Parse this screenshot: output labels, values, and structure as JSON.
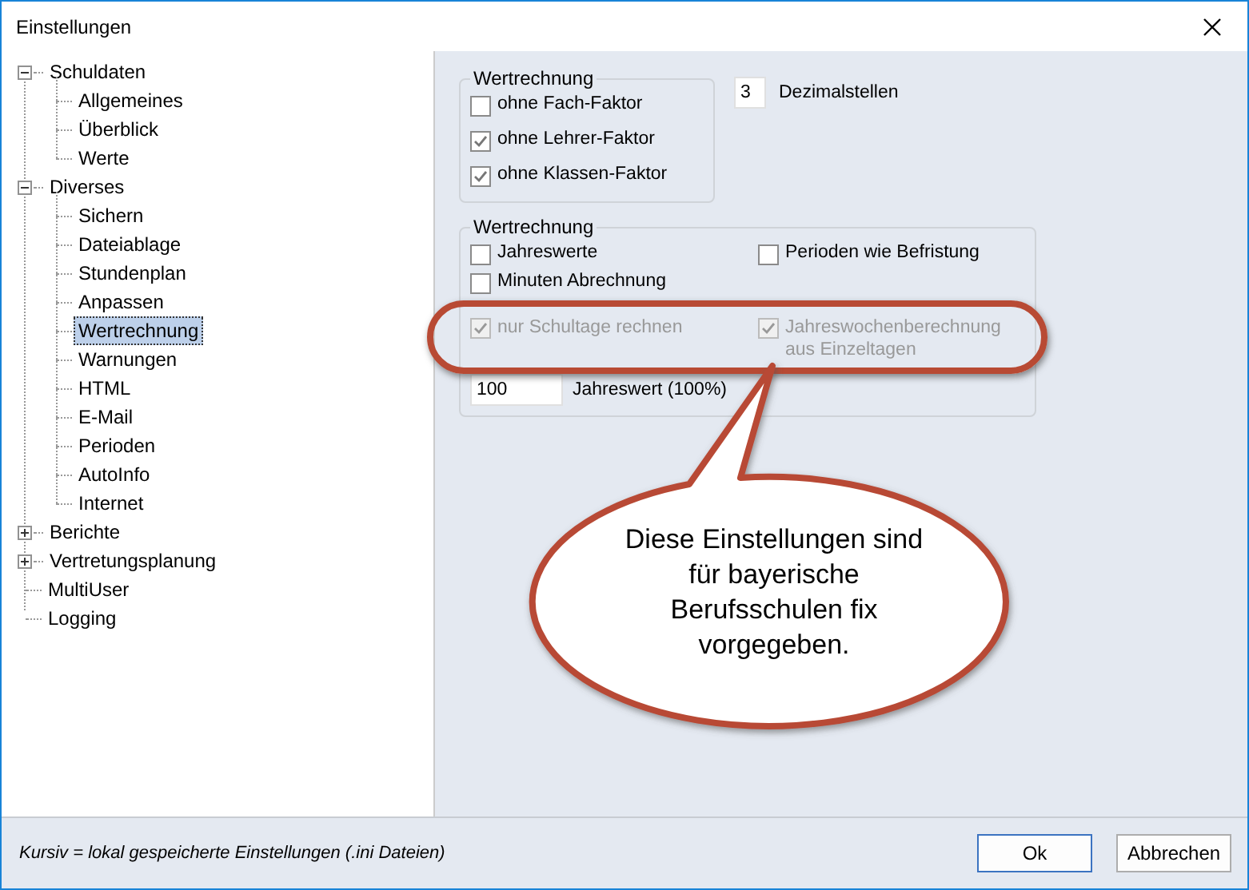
{
  "window": {
    "title": "Einstellungen"
  },
  "tree": [
    {
      "label": "Schuldaten",
      "expanded": true,
      "selected": false,
      "children": [
        {
          "label": "Allgemeines",
          "selected": false
        },
        {
          "label": "Überblick",
          "selected": false
        },
        {
          "label": "Werte",
          "selected": false
        }
      ]
    },
    {
      "label": "Diverses",
      "expanded": true,
      "selected": false,
      "children": [
        {
          "label": "Sichern",
          "selected": false
        },
        {
          "label": "Dateiablage",
          "selected": false
        },
        {
          "label": "Stundenplan",
          "selected": false
        },
        {
          "label": "Anpassen",
          "selected": false
        },
        {
          "label": "Wertrechnung",
          "selected": true
        },
        {
          "label": "Warnungen",
          "selected": false
        },
        {
          "label": "HTML",
          "selected": false
        },
        {
          "label": "E-Mail",
          "selected": false
        },
        {
          "label": "Perioden",
          "selected": false
        },
        {
          "label": "AutoInfo",
          "selected": false
        },
        {
          "label": "Internet",
          "selected": false
        }
      ]
    },
    {
      "label": "Berichte",
      "expanded": false,
      "selected": false
    },
    {
      "label": "Vertretungsplanung",
      "expanded": false,
      "selected": false
    },
    {
      "label": "MultiUser",
      "selected": false
    },
    {
      "label": "Logging",
      "selected": false
    }
  ],
  "group1": {
    "legend": "Wertrechnung",
    "checkboxes": [
      {
        "label": "ohne Fach-Faktor",
        "checked": false
      },
      {
        "label": "ohne Lehrer-Faktor",
        "checked": true
      },
      {
        "label": "ohne Klassen-Faktor",
        "checked": true
      }
    ]
  },
  "decimals": {
    "value": "3",
    "label": "Dezimalstellen"
  },
  "group2": {
    "legend": "Wertrechnung",
    "rows": [
      [
        {
          "label": "Jahreswerte",
          "checked": false,
          "disabled": false
        },
        {
          "label": "Perioden wie Befristung",
          "checked": false,
          "disabled": false
        }
      ],
      [
        {
          "label": "Minuten Abrechnung",
          "checked": false,
          "disabled": false
        }
      ],
      [
        {
          "label": "nur Schultage rechnen",
          "checked": true,
          "disabled": true
        },
        {
          "label": "Jahreswochenberechnung aus Einzeltagen",
          "checked": true,
          "disabled": true
        }
      ]
    ],
    "year_value": {
      "value": "100",
      "label": "Jahreswert (100%)"
    }
  },
  "callout": {
    "text": "Diese Einstellungen sind für bayerische Berufsschulen fix vorgegeben."
  },
  "footer": {
    "note": "Kursiv = lokal gespeicherte Einstellungen (.ini Dateien)",
    "buttons": [
      {
        "label": "Ok",
        "default": true
      },
      {
        "label": "Abbrechen",
        "default": false
      }
    ]
  }
}
